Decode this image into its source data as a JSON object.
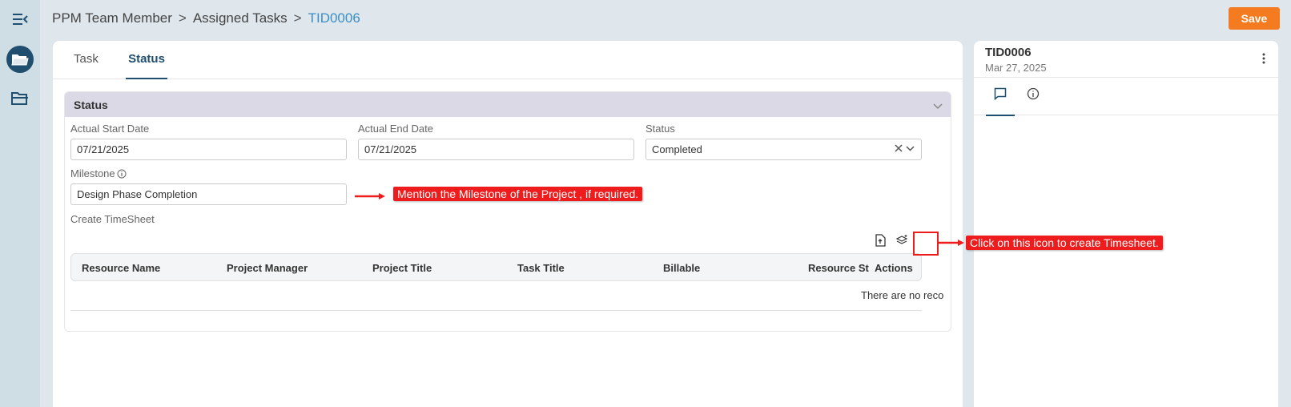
{
  "breadcrumb": {
    "items": [
      "PPM Team Member",
      "Assigned Tasks"
    ],
    "current": "TID0006",
    "separator": ">"
  },
  "toolbar": {
    "save_label": "Save"
  },
  "tabs": [
    "Task",
    "Status"
  ],
  "section": {
    "title": "Status"
  },
  "fields": {
    "actual_start": {
      "label": "Actual Start Date",
      "value": "07/21/2025"
    },
    "actual_end": {
      "label": "Actual End Date",
      "value": "07/21/2025"
    },
    "status": {
      "label": "Status",
      "value": "Completed"
    },
    "milestone": {
      "label": "Milestone",
      "value": "Design Phase Completion"
    }
  },
  "timesheet": {
    "label": "Create TimeSheet",
    "columns": [
      "Resource Name",
      "Project Manager",
      "Project Title",
      "Task Title",
      "Billable",
      "Resource St",
      "Actions"
    ],
    "empty_text": "There are no records to display"
  },
  "side": {
    "title": "TID0006",
    "date": "Mar 27, 2025"
  },
  "annotations": {
    "milestone_note": "Mention the Milestone of the Project , if required.",
    "timesheet_note": "Click on this icon to create Timesheet."
  },
  "colors": {
    "accent": "#1f4e6e",
    "link": "#3a8fc7",
    "save": "#f47b20",
    "annotation": "#ee1c1c"
  }
}
